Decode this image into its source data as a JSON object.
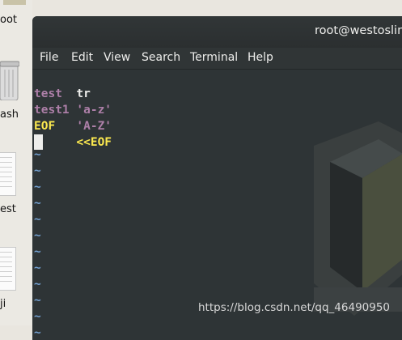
{
  "desktop": {
    "home_label": "oot",
    "trash_label": "ash",
    "file1_label": "est",
    "file2_label": "ji"
  },
  "window": {
    "title": "root@westoslin"
  },
  "menu": [
    "File",
    "Edit",
    "View",
    "Search",
    "Terminal",
    "Help"
  ],
  "terminal": {
    "line1": {
      "cmd": "tr",
      "arg1": "'a-z'",
      "arg2": "'A-Z'",
      "heredoc": "<<EOF"
    },
    "line2": "test",
    "line3": "test1",
    "line4": "EOF",
    "tilde": "~",
    "tilde_count": 12
  },
  "watermark_text": "https://blog.csdn.net/qq_46490950",
  "colors": {
    "terminal_bg": "#2e3436",
    "text_white": "#eeeeec",
    "keyword_yellow": "#fce94f",
    "string_purple": "#ad7fa8",
    "tilde_blue": "#729fcf"
  }
}
